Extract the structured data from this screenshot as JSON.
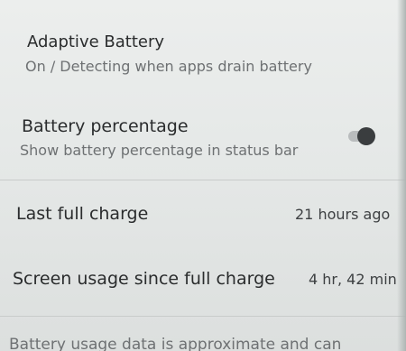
{
  "settings": {
    "adaptive_battery": {
      "title": "Adaptive Battery",
      "subtitle": "On / Detecting when apps drain battery"
    },
    "battery_percentage": {
      "title": "Battery percentage",
      "subtitle": "Show battery percentage in status bar",
      "toggle_state": "off"
    },
    "last_full_charge": {
      "title": "Last full charge",
      "value": "21 hours ago"
    },
    "screen_usage": {
      "title": "Screen usage since full charge",
      "value": "4 hr, 42 min"
    },
    "footer_note": "Battery usage data is approximate and can"
  }
}
